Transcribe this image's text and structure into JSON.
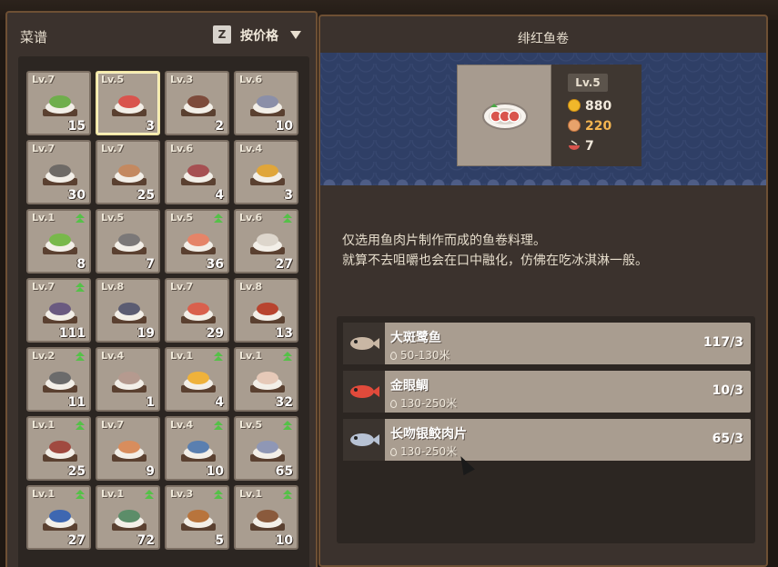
{
  "left_panel": {
    "title": "菜谱",
    "sort_key": "Z",
    "sort_label": "按价格"
  },
  "recipes": [
    {
      "level": "Lv.7",
      "count": "15",
      "upgrade": false,
      "icon": "green-vegetables-bowl",
      "color": "#6fae4c"
    },
    {
      "level": "Lv.5",
      "count": "3",
      "upgrade": false,
      "icon": "fish-roll-plate",
      "color": "#d9544d",
      "selected": true
    },
    {
      "level": "Lv.3",
      "count": "2",
      "upgrade": false,
      "icon": "steak-salad-plate",
      "color": "#7d4b3b"
    },
    {
      "level": "Lv.6",
      "count": "10",
      "upgrade": false,
      "icon": "fish-sushi-board",
      "color": "#8b8fa8"
    },
    {
      "level": "Lv.7",
      "count": "30",
      "upgrade": false,
      "icon": "dark-fish-sushi",
      "color": "#6e6a66"
    },
    {
      "level": "Lv.7",
      "count": "25",
      "upgrade": false,
      "icon": "teal-board-sushi",
      "color": "#c48960"
    },
    {
      "level": "Lv.6",
      "count": "4",
      "upgrade": false,
      "icon": "red-fish-sushi",
      "color": "#a65052"
    },
    {
      "level": "Lv.4",
      "count": "3",
      "upgrade": false,
      "icon": "omelet-plate",
      "color": "#e0a63a"
    },
    {
      "level": "Lv.1",
      "count": "8",
      "upgrade": true,
      "icon": "green-rolls-plate",
      "color": "#78b84a"
    },
    {
      "level": "Lv.5",
      "count": "7",
      "upgrade": false,
      "icon": "grey-fish-sushi",
      "color": "#7b7878"
    },
    {
      "level": "Lv.5",
      "count": "36",
      "upgrade": true,
      "icon": "salmon-sushi",
      "color": "#e58468"
    },
    {
      "level": "Lv.6",
      "count": "27",
      "upgrade": true,
      "icon": "white-fish-sushi",
      "color": "#ddd6cc"
    },
    {
      "level": "Lv.7",
      "count": "111",
      "upgrade": true,
      "icon": "purple-board-sushi",
      "color": "#6a5a80"
    },
    {
      "level": "Lv.8",
      "count": "19",
      "upgrade": false,
      "icon": "purple-fish-sushi",
      "color": "#5b5c72"
    },
    {
      "level": "Lv.7",
      "count": "29",
      "upgrade": false,
      "icon": "tuna-sushi",
      "color": "#d9604d"
    },
    {
      "level": "Lv.8",
      "count": "13",
      "upgrade": false,
      "icon": "sashimi-platter",
      "color": "#b8442f"
    },
    {
      "level": "Lv.2",
      "count": "11",
      "upgrade": true,
      "icon": "green-board-sushi",
      "color": "#6b6b6b"
    },
    {
      "level": "Lv.4",
      "count": "1",
      "upgrade": false,
      "icon": "teal-fish-sushi",
      "color": "#b59a8f"
    },
    {
      "level": "Lv.1",
      "count": "4",
      "upgrade": true,
      "icon": "fried-egg-plate",
      "color": "#efb23b"
    },
    {
      "level": "Lv.1",
      "count": "32",
      "upgrade": true,
      "icon": "flower-platter",
      "color": "#e6c9b8"
    },
    {
      "level": "Lv.1",
      "count": "25",
      "upgrade": true,
      "icon": "red-board-sushi",
      "color": "#a04a40"
    },
    {
      "level": "Lv.7",
      "count": "9",
      "upgrade": false,
      "icon": "shrimp-sushi",
      "color": "#d88d5d"
    },
    {
      "level": "Lv.4",
      "count": "10",
      "upgrade": true,
      "icon": "blue-fin-sushi",
      "color": "#5a7fb0"
    },
    {
      "level": "Lv.5",
      "count": "65",
      "upgrade": true,
      "icon": "purple-silver-sushi",
      "color": "#8f97b5"
    },
    {
      "level": "Lv.1",
      "count": "27",
      "upgrade": true,
      "icon": "blue-fish-sushi",
      "color": "#3e67b1"
    },
    {
      "level": "Lv.1",
      "count": "72",
      "upgrade": true,
      "icon": "green-fish-sushi",
      "color": "#5c8d69"
    },
    {
      "level": "Lv.3",
      "count": "5",
      "upgrade": true,
      "icon": "fried-balls-plate",
      "color": "#b8743c"
    },
    {
      "level": "Lv.1",
      "count": "10",
      "upgrade": true,
      "icon": "brown-fish-sushi",
      "color": "#8a5a3c"
    }
  ],
  "detail": {
    "title": "绯红鱼卷",
    "level": "Lv.5",
    "price": "880",
    "likability": "220",
    "portions": "7",
    "description_line1": "仅选用鱼肉片制作而成的鱼卷料理。",
    "description_line2": "就算不去咀嚼也会在口中融化，仿佛在吃冰淇淋一般。"
  },
  "ingredients": [
    {
      "name": "大斑鹭鱼",
      "location": "50-130米",
      "count": "117/3",
      "icon": "spotted-fish-icon"
    },
    {
      "name": "金眼鲷",
      "location": "130-250米",
      "count": "10/3",
      "icon": "red-fish-icon"
    },
    {
      "name": "长吻银鲛肉片",
      "location": "130-250米",
      "count": "65/3",
      "icon": "silver-fish-icon"
    }
  ]
}
